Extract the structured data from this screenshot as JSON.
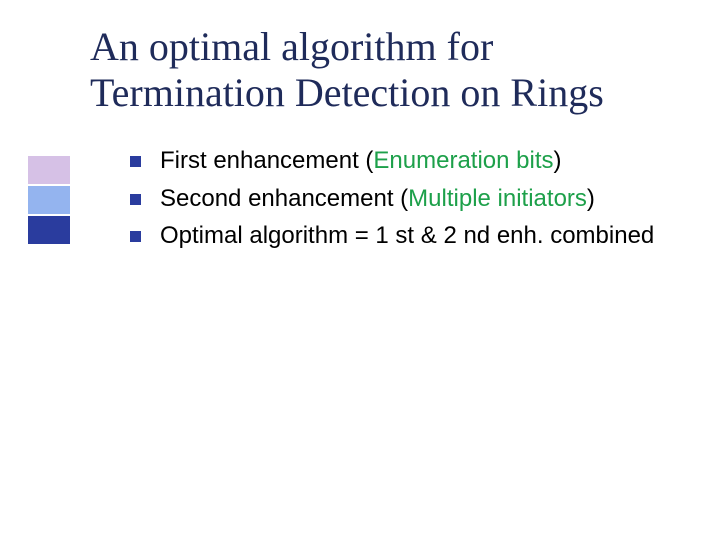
{
  "title": "An optimal algorithm for Termination Detection on Rings",
  "bullets": [
    {
      "prefix": "First enhancement (",
      "highlight": "Enumeration bits",
      "suffix": ")"
    },
    {
      "prefix": "Second enhancement (",
      "highlight": "Multiple initiators",
      "suffix": ")"
    },
    {
      "prefix": "Optimal algorithm = 1 st & 2 nd enh. combined",
      "highlight": "",
      "suffix": ""
    }
  ]
}
